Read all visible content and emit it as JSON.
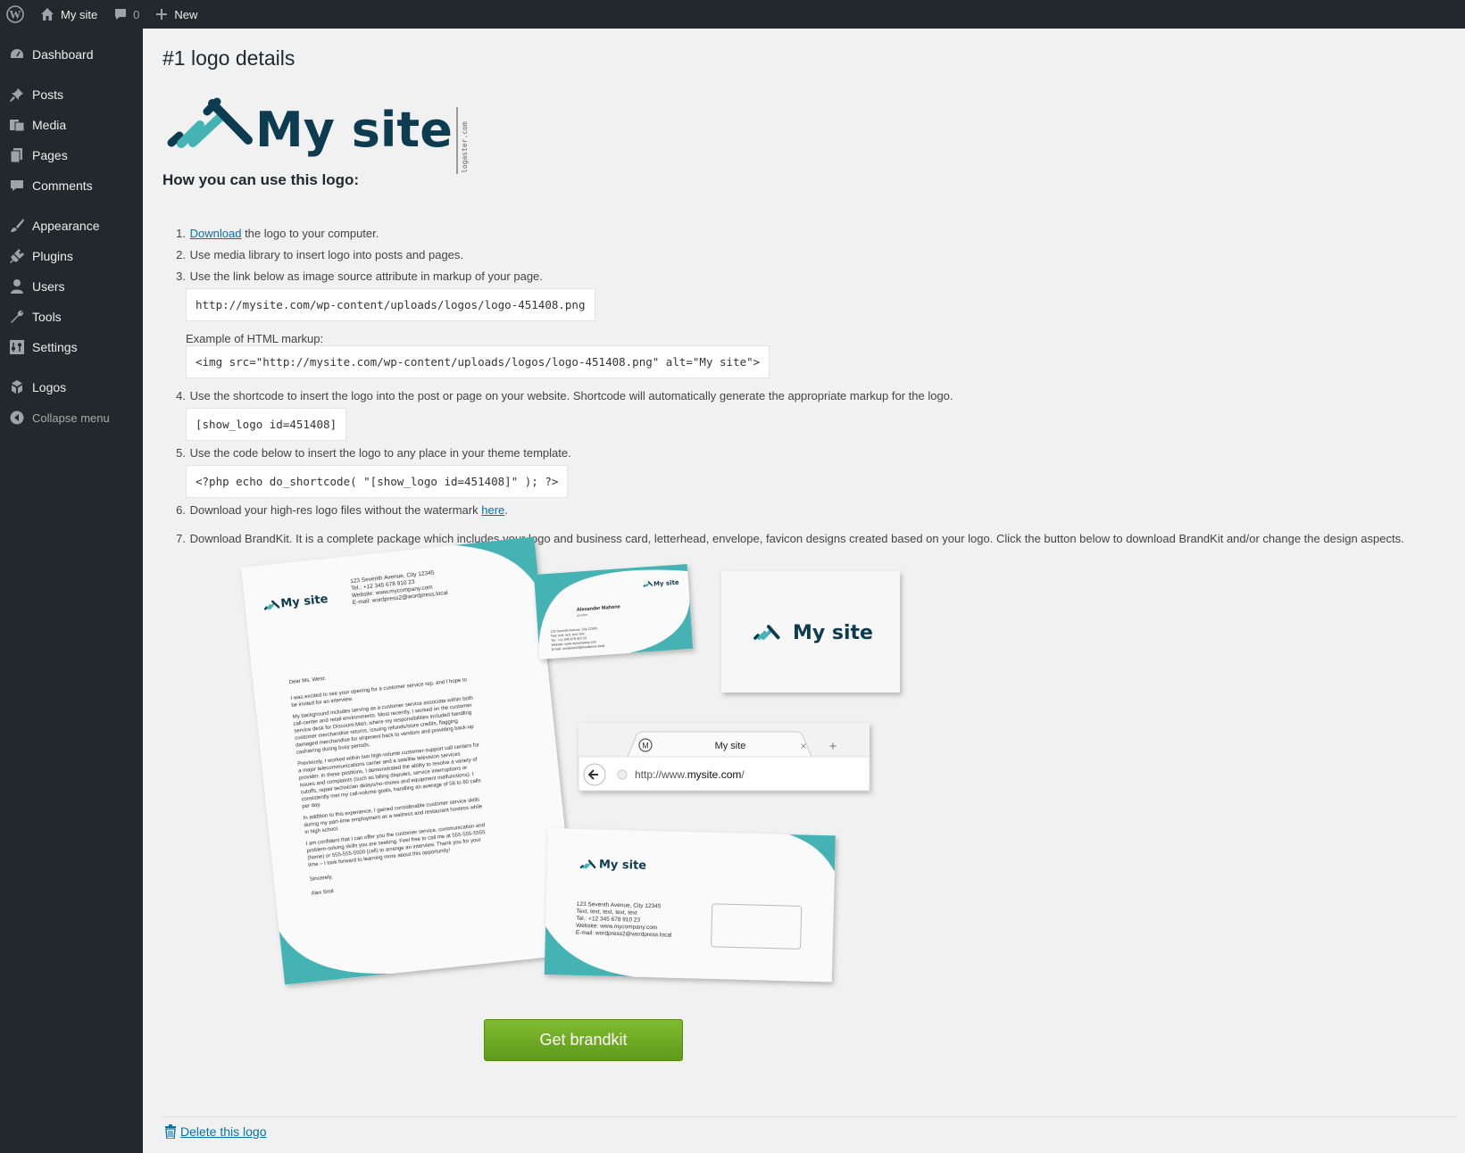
{
  "adminbar": {
    "site_name": "My site",
    "comments_count": "0",
    "new_label": "New"
  },
  "sidebar": {
    "items": [
      {
        "label": "Dashboard",
        "icon": "dashboard-icon"
      },
      {
        "label": "Posts",
        "icon": "pin-icon"
      },
      {
        "label": "Media",
        "icon": "media-icon"
      },
      {
        "label": "Pages",
        "icon": "pages-icon"
      },
      {
        "label": "Comments",
        "icon": "comment-icon"
      },
      {
        "label": "Appearance",
        "icon": "brush-icon"
      },
      {
        "label": "Plugins",
        "icon": "plugin-icon"
      },
      {
        "label": "Users",
        "icon": "user-icon"
      },
      {
        "label": "Tools",
        "icon": "wrench-icon"
      },
      {
        "label": "Settings",
        "icon": "settings-icon"
      },
      {
        "label": "Logos",
        "icon": "logos-icon"
      }
    ],
    "collapse_label": "Collapse menu"
  },
  "page": {
    "title": "#1 logo details",
    "logo_text": "My site",
    "logo_watermark": "logaster.com",
    "howto_heading": "How you can use this logo:",
    "step1_link": "Download",
    "step1_rest": " the logo to your computer.",
    "step2": "Use media library to insert logo into posts and pages.",
    "step3": "Use the link below as image source attribute in markup of your page.",
    "step3_url": "http://mysite.com/wp-content/uploads/logos/logo-451408.png",
    "step3_example_label": "Example of HTML markup:",
    "step3_example_code": "<img src=\"http://mysite.com/wp-content/uploads/logos/logo-451408.png\" alt=\"My site\">",
    "step4": "Use the shortcode to insert the logo into the post or page on your website. Shortcode will automatically generate the appropriate markup for the logo.",
    "step4_code": "[show_logo id=451408]",
    "step5": "Use the code below to insert the logo to any place in your theme template.",
    "step5_code": "<?php echo do_shortcode( \"[show_logo id=451408]\" ); ?>",
    "step6_text": "Download your high-res logo files without the watermark ",
    "step6_link": "here",
    "step6_end": ".",
    "step7": "Download BrandKit. It is a complete package which includes your logo and business card, letterhead, envelope, favicon designs created based on your logo. Click the button below to download BrandKit and/or change the design aspects.",
    "get_brandkit_label": "Get brandkit",
    "delete_label": "Delete this logo"
  },
  "brandkit_preview": {
    "letter_logo": "My site",
    "letter_address": [
      "123 Seventh Avenue, City 12345",
      "Tel.: +12 345 678 910 23",
      "Website: www.mycompany.com",
      "E-mail: wordpress2@wordpress.local"
    ],
    "letter_greeting": "Dear Ms. West:",
    "letter_body": [
      "I was excited to see your opening for a customer service rep, and I hope to",
      "be invited for an interview.",
      "",
      "My background includes serving as a customer service associate within both",
      "call-center and retail environments. Most recently, I worked on the customer",
      "service desk for Discount-Mart, where my responsibilities included handling",
      "customer merchandise returns, issuing refunds/store credits, flagging",
      "damaged merchandise for shipment back to vendors and providing back-up",
      "cashiering during busy periods.",
      "",
      "Previously, I worked within two high-volume customer-support call centers for",
      "a major telecommunications carrier and a satellite television services",
      "provider. In these positions, I demonstrated the ability to resolve a variety of",
      "issues and complaints (such as billing disputes, service interruptions or",
      "cutoffs, repair technician delays/no-shows and equipment malfunctions). I",
      "consistently met my call-volume goals, handling an average of 56 to 60 calls",
      "per day.",
      "",
      "In addition to this experience, I gained considerable customer service skills",
      "during my part-time employment as a waitress and restaurant hostess while",
      "in high school.",
      "",
      "I am confident that I can offer you the customer service, communication and",
      "problem-solving skills you are seeking. Feel free to call me at 555-555-5555",
      "(home) or 555-555-5500 (cell) to arrange an interview. Thank you for your",
      "time – I look forward to learning more about this opportunity!"
    ],
    "letter_closing": "Sincerely,",
    "letter_signature": "Alex Smit",
    "card_logo": "My site",
    "card_name": "Alexander Mahone",
    "card_position": "position",
    "card_lines": [
      "123 Seventh Avenue, City 12345",
      "Text, text, text, text, text",
      "Tel.: +12 345 678 910 23",
      "Website: www.mycompany.com",
      "E-mail: wordpress2@wordpress.local"
    ],
    "square_logo": "My site",
    "browser_tab_title": "My site",
    "browser_favicon_letter": "M",
    "browser_url_prefix": "http://www.",
    "browser_url_domain": "mysite.com",
    "browser_url_suffix": "/",
    "envelope_logo": "My site",
    "envelope_lines": [
      "123 Seventh Avenue, City 12345",
      "Text, text, text, text, text",
      "Tel.: +12 345 678 910 23",
      "Website: www.mycompany.com",
      "E-mail: wordpress2@wordpress.local"
    ]
  },
  "colors": {
    "brand_teal": "#45b3b3",
    "brand_dark": "#0d3b4f",
    "admin_bg": "#23282d",
    "link": "#0073aa",
    "button_green": "#6aa924"
  }
}
